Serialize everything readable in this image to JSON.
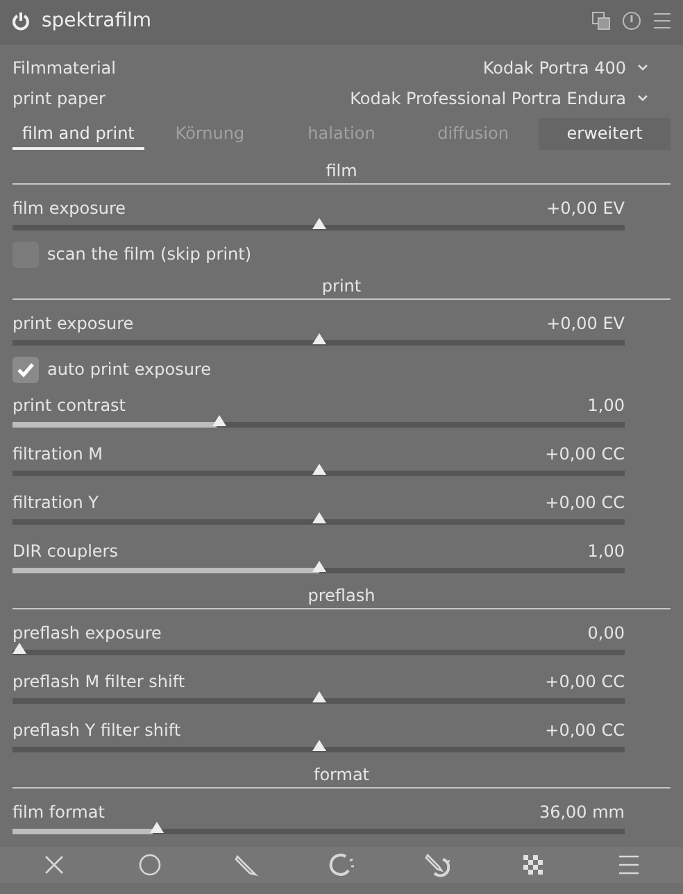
{
  "header": {
    "title": "spektrafilm",
    "enabled": true
  },
  "selectors": [
    {
      "label": "Filmmaterial",
      "value": "Kodak Portra 400"
    },
    {
      "label": "print paper",
      "value": "Kodak Professional Portra Endura"
    }
  ],
  "tabs": [
    {
      "label": "film and print",
      "selected": true,
      "hovered": false
    },
    {
      "label": "Körnung",
      "selected": false,
      "hovered": false
    },
    {
      "label": "halation",
      "selected": false,
      "hovered": false
    },
    {
      "label": "diffusion",
      "selected": false,
      "hovered": false
    },
    {
      "label": "erweitert",
      "selected": false,
      "hovered": true
    }
  ],
  "rows": [
    {
      "kind": "section",
      "label": "film"
    },
    {
      "kind": "bipolar",
      "label": "film exposure",
      "reading": "+0,00 EV",
      "level": 0.5
    },
    {
      "kind": "checkbox",
      "label": "scan the film (skip print)",
      "checked": false
    },
    {
      "kind": "section",
      "label": "print"
    },
    {
      "kind": "bipolar",
      "label": "print exposure",
      "reading": "+0,00 EV",
      "level": 0.5
    },
    {
      "kind": "checkbox",
      "label": "auto print exposure",
      "checked": true
    },
    {
      "kind": "slider",
      "label": "print contrast",
      "reading": "1,00",
      "level": 0.333
    },
    {
      "kind": "bipolar",
      "label": "filtration M",
      "reading": "+0,00 CC",
      "level": 0.5
    },
    {
      "kind": "bipolar",
      "label": "filtration Y",
      "reading": "+0,00 CC",
      "level": 0.5
    },
    {
      "kind": "slider",
      "label": "DIR couplers",
      "reading": "1,00",
      "level": 0.5
    },
    {
      "kind": "section",
      "label": "preflash"
    },
    {
      "kind": "slider",
      "label": "preflash exposure",
      "reading": "0,00",
      "level": 0
    },
    {
      "kind": "bipolar",
      "label": "preflash M filter shift",
      "reading": "+0,00 CC",
      "level": 0.5
    },
    {
      "kind": "bipolar",
      "label": "preflash Y filter shift",
      "reading": "+0,00 CC",
      "level": 0.5
    },
    {
      "kind": "section",
      "label": "format"
    },
    {
      "kind": "slider",
      "label": "film format",
      "reading": "36,00 mm",
      "level": 0.23
    }
  ],
  "footer": [
    {
      "kind": "off"
    },
    {
      "kind": "uniform"
    },
    {
      "kind": "drawn"
    },
    {
      "kind": "parametric"
    },
    {
      "kind": "drawn-parametric"
    },
    {
      "kind": "raster"
    },
    {
      "kind": "menu"
    }
  ]
}
